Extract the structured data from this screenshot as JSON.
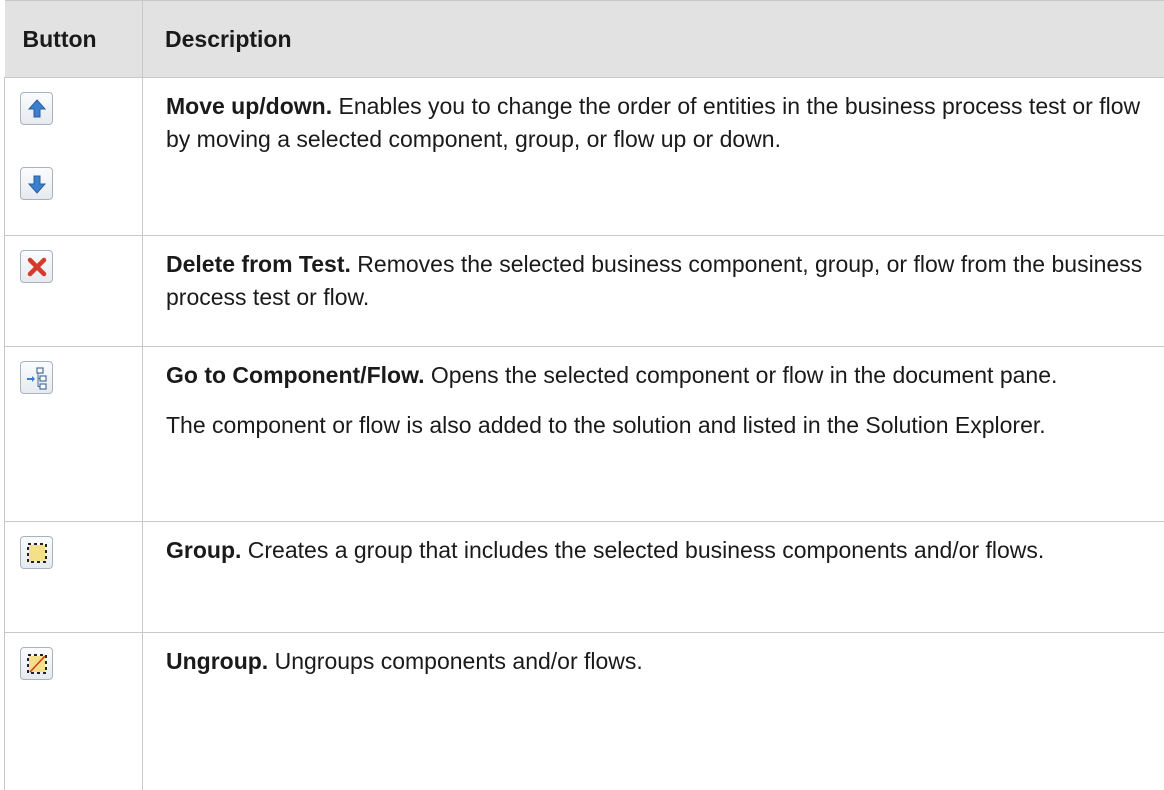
{
  "table": {
    "headers": {
      "button": "Button",
      "description": "Description"
    },
    "rows": [
      {
        "icons": [
          "arrow-up-icon",
          "arrow-down-icon"
        ],
        "title": "Move up/down.",
        "text": " Enables you to change the order of entities in the business process test or flow by moving a selected component, group, or flow up or down."
      },
      {
        "icons": [
          "delete-x-icon"
        ],
        "title": "Delete from Test.",
        "text": " Removes the selected business component, group, or flow from the business process test or flow."
      },
      {
        "icons": [
          "go-to-component-icon"
        ],
        "title": "Go to Component/Flow.",
        "text": " Opens the selected component or flow in the document pane.",
        "text2": "The component or flow is also added to the solution and listed in the Solution Explorer."
      },
      {
        "icons": [
          "group-icon"
        ],
        "title": "Group.",
        "text": " Creates a group that includes the selected business components and/or flows."
      },
      {
        "icons": [
          "ungroup-icon"
        ],
        "title": "Ungroup.",
        "text": " Ungroups components and/or flows."
      }
    ]
  },
  "colors": {
    "header_bg": "#e2e2e2",
    "border": "#c8c8c8",
    "arrow_blue": "#3b7fd0",
    "delete_red": "#d63a2a",
    "group_yellow": "#f5e08a"
  }
}
